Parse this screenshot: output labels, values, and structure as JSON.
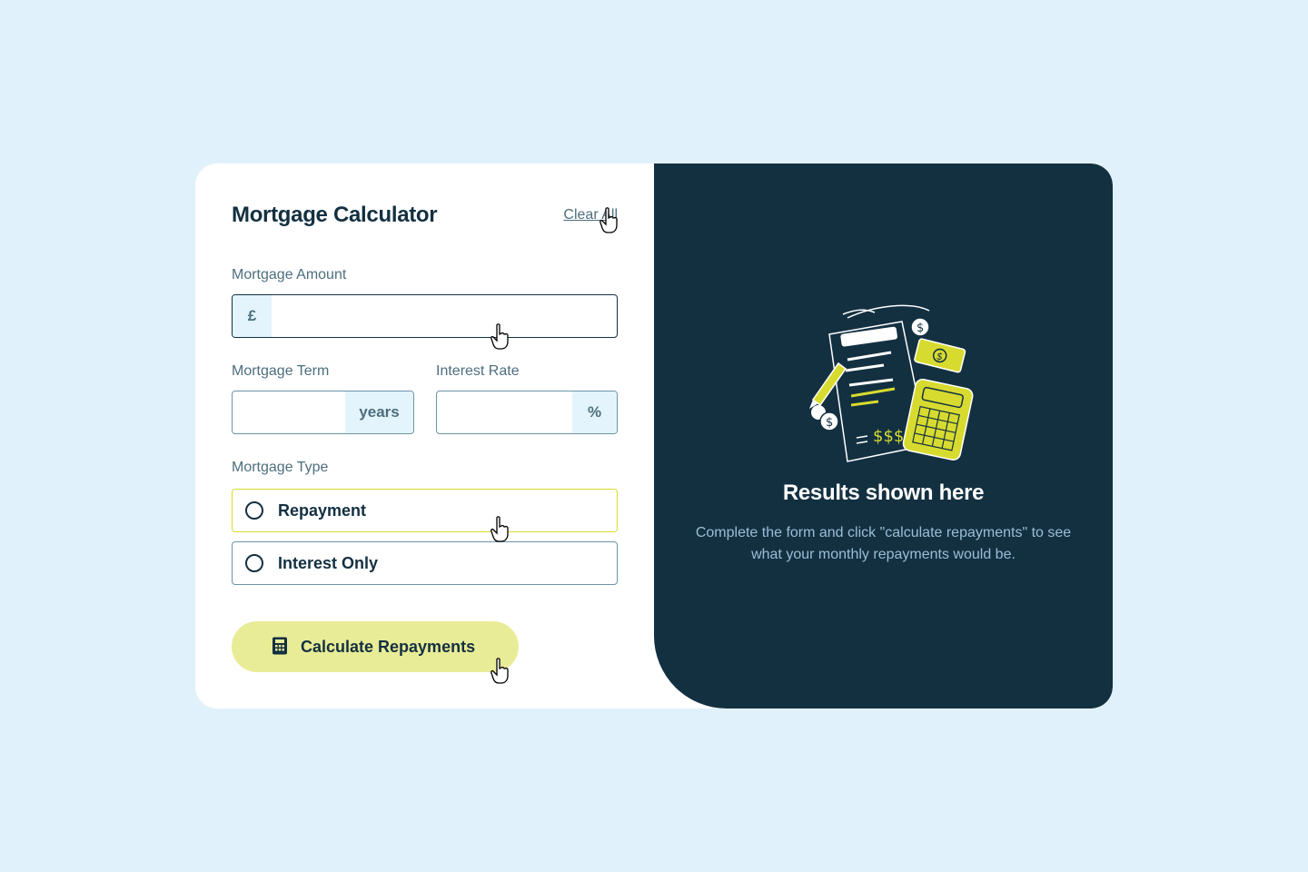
{
  "form": {
    "title": "Mortgage Calculator",
    "clear_all_label": "Clear All",
    "amount": {
      "label": "Mortgage Amount",
      "prefix": "£",
      "value": ""
    },
    "term": {
      "label": "Mortgage Term",
      "suffix": "years",
      "value": ""
    },
    "rate": {
      "label": "Interest Rate",
      "suffix": "%",
      "value": ""
    },
    "type": {
      "label": "Mortgage Type",
      "options": [
        {
          "label": "Repayment",
          "selected": false
        },
        {
          "label": "Interest Only",
          "selected": false
        }
      ]
    },
    "submit_label": "Calculate Repayments"
  },
  "results": {
    "title": "Results shown here",
    "description": "Complete the form and click \"calculate repayments\" to see what your monthly repayments would be."
  },
  "colors": {
    "page_bg": "#e0f1fc",
    "dark_panel": "#133041",
    "lime": "#d8db2f",
    "button_bg": "#e9ec96"
  },
  "icons": {
    "button_icon": "calculator-icon",
    "cursor": "hand-pointer-icon",
    "illustration": "empty-results-illustration"
  }
}
